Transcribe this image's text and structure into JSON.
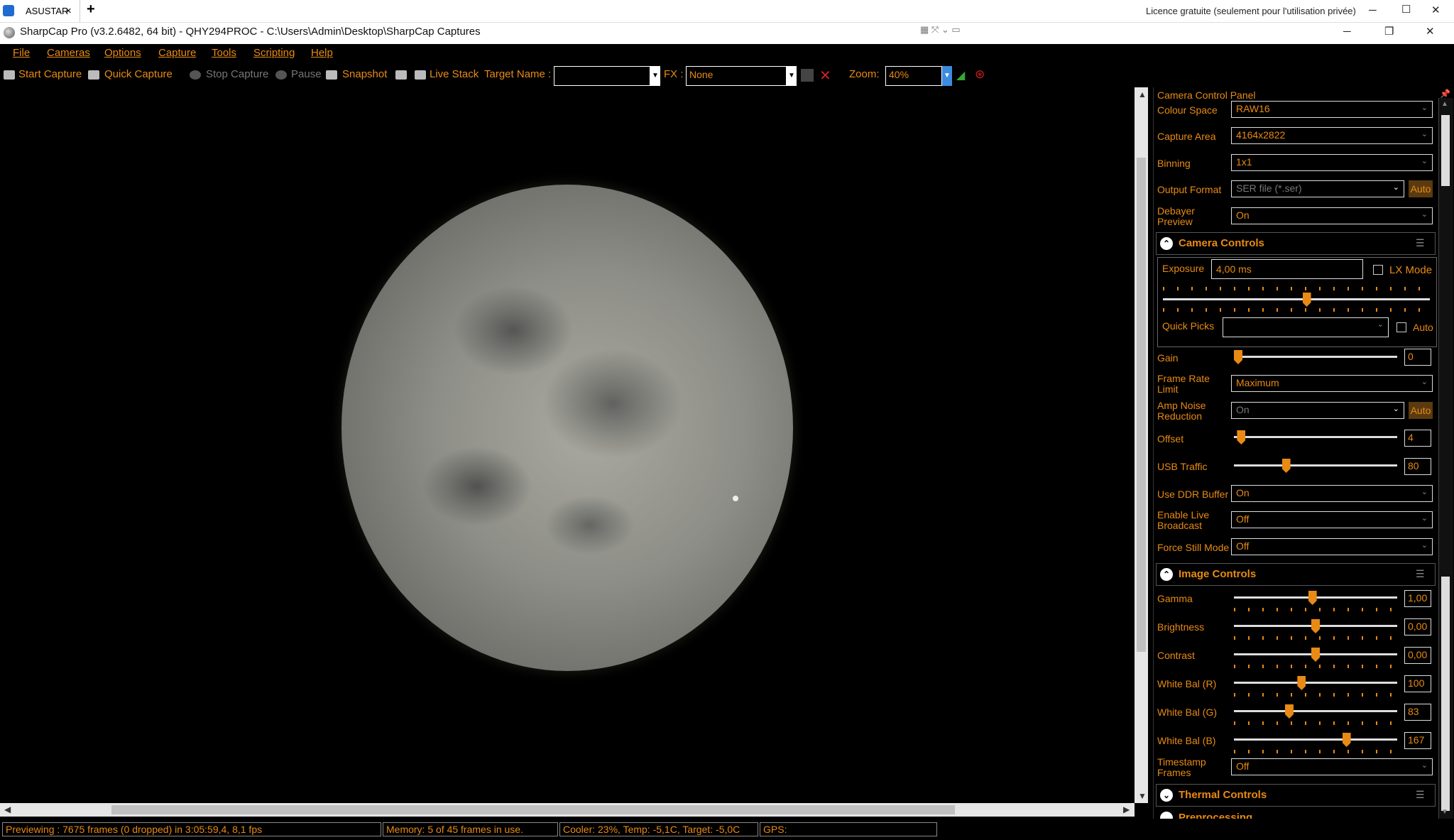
{
  "remote": {
    "tab_label": "ASUSTAR",
    "tab_close": "×",
    "new_tab": "+",
    "licence": "Licence gratuite (seulement pour l'utilisation privée)"
  },
  "window": {
    "title": "SharpCap Pro (v3.2.6482, 64 bit) - QHY294PROC - C:\\Users\\Admin\\Desktop\\SharpCap Captures",
    "minimize": "─",
    "restore": "❐",
    "close": "✕"
  },
  "menu": [
    "File",
    "Cameras",
    "Options",
    "Capture",
    "Tools",
    "Scripting",
    "Help"
  ],
  "toolbar": {
    "start_capture": "Start Capture",
    "quick_capture": "Quick Capture",
    "stop_capture": "Stop Capture",
    "pause": "Pause",
    "snapshot": "Snapshot",
    "live_stack": "Live Stack",
    "target_name_label": "Target Name :",
    "target_name_value": "",
    "fx_label": "FX :",
    "fx_value": "None",
    "zoom_label": "Zoom:",
    "zoom_value": "40%"
  },
  "status": {
    "previewing": "Previewing : 7675 frames (0 dropped) in 3:05:59,4, 8,1 fps",
    "memory": "Memory: 5 of 45 frames in use.",
    "cooler": "Cooler: 23%, Temp: -5,1C, Target: -5,0C",
    "gps": "GPS:"
  },
  "panel": {
    "title": "Camera Control Panel",
    "colour_space": {
      "label": "Colour Space",
      "value": "RAW16"
    },
    "capture_area": {
      "label": "Capture Area",
      "value": "4164x2822"
    },
    "binning": {
      "label": "Binning",
      "value": "1x1"
    },
    "output_format": {
      "label": "Output Format",
      "value": "SER file (*.ser)",
      "auto": "Auto"
    },
    "debayer_preview": {
      "label1": "Debayer",
      "label2": "Preview",
      "value": "On"
    },
    "camera_controls": {
      "title": "Camera Controls",
      "exposure_label": "Exposure",
      "exposure_value": "4,00 ms",
      "lx_mode": "LX Mode",
      "exposure_level": 0.54,
      "quick_picks_label": "Quick Picks",
      "quick_picks_value": "",
      "auto": "Auto",
      "gain": {
        "label": "Gain",
        "value": "0",
        "level": 0.0
      },
      "frame_rate": {
        "label1": "Frame Rate",
        "label2": "Limit",
        "value": "Maximum"
      },
      "amp_noise": {
        "label1": "Amp Noise",
        "label2": "Reduction",
        "value": "On",
        "auto": "Auto"
      },
      "offset": {
        "label": "Offset",
        "value": "4",
        "level": 0.02
      },
      "usb_traffic": {
        "label": "USB Traffic",
        "value": "80",
        "level": 0.31
      },
      "ddr_buffer": {
        "label": "Use DDR Buffer",
        "value": "On"
      },
      "live_broadcast": {
        "label1": "Enable Live",
        "label2": "Broadcast",
        "value": "Off"
      },
      "force_still": {
        "label": "Force Still Mode",
        "value": "Off"
      }
    },
    "image_controls": {
      "title": "Image Controls",
      "gamma": {
        "label": "Gamma",
        "value": "1,00",
        "level": 0.48
      },
      "brightness": {
        "label": "Brightness",
        "value": "0,00",
        "level": 0.5
      },
      "contrast": {
        "label": "Contrast",
        "value": "0,00",
        "level": 0.5
      },
      "wb_r": {
        "label": "White Bal (R)",
        "value": "100",
        "level": 0.41
      },
      "wb_g": {
        "label": "White Bal (G)",
        "value": "83",
        "level": 0.33
      },
      "wb_b": {
        "label": "White Bal (B)",
        "value": "167",
        "level": 0.7
      },
      "timestamp": {
        "label1": "Timestamp",
        "label2": "Frames",
        "value": "Off"
      }
    },
    "thermal_controls": {
      "title": "Thermal Controls"
    },
    "preprocessing": {
      "title": "Preprocessing"
    }
  },
  "colors": {
    "accent": "#e88a14",
    "background": "#000000"
  }
}
